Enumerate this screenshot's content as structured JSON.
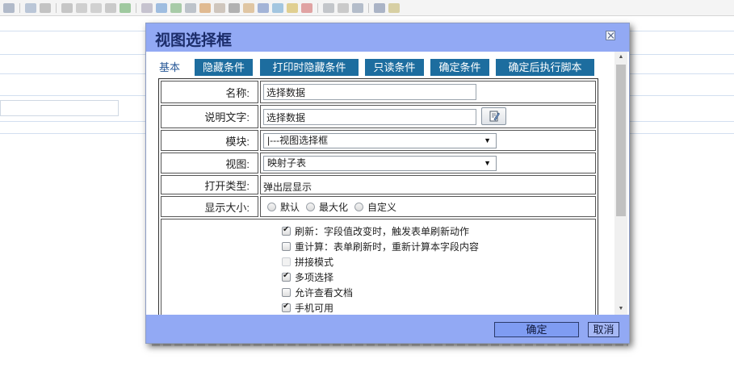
{
  "dialog": {
    "title": "视图选择框",
    "tabs": [
      {
        "label": "基本"
      },
      {
        "label": "隐藏条件"
      },
      {
        "label": "打印时隐藏条件"
      },
      {
        "label": "只读条件"
      },
      {
        "label": "确定条件"
      },
      {
        "label": "确定后执行脚本"
      }
    ]
  },
  "form": {
    "name": {
      "label": "名称:",
      "value": "选择数据"
    },
    "description": {
      "label": "说明文字:",
      "value": "选择数据"
    },
    "module": {
      "label": "模块:",
      "value": "|---视图选择框"
    },
    "view": {
      "label": "视图:",
      "value": "映射子表"
    },
    "open_type": {
      "label": "打开类型:",
      "value": "弹出层显示"
    },
    "display_size": {
      "label": "显示大小:",
      "options": [
        {
          "label": "默认",
          "selected": false
        },
        {
          "label": "最大化",
          "selected": false
        },
        {
          "label": "自定义",
          "selected": false
        }
      ]
    },
    "options": [
      {
        "label": "刷新：字段值改变时，触发表单刷新动作",
        "checked": true,
        "disabled": false
      },
      {
        "label": "重计算：表单刷新时，重新计算本字段内容",
        "checked": false,
        "disabled": false
      },
      {
        "label": "拼接模式",
        "checked": false,
        "disabled": true
      },
      {
        "label": "多项选择",
        "checked": true,
        "disabled": false
      },
      {
        "label": "允许查看文档",
        "checked": false,
        "disabled": false
      },
      {
        "label": "手机可用",
        "checked": true,
        "disabled": false
      }
    ]
  },
  "footer": {
    "ok_label": "确定",
    "cancel_label": "取消"
  },
  "colors": {
    "header_bg": "#92a9f4",
    "tab_button_bg": "#1d6d9f",
    "ok_button_bg": "#7f9cf2"
  }
}
